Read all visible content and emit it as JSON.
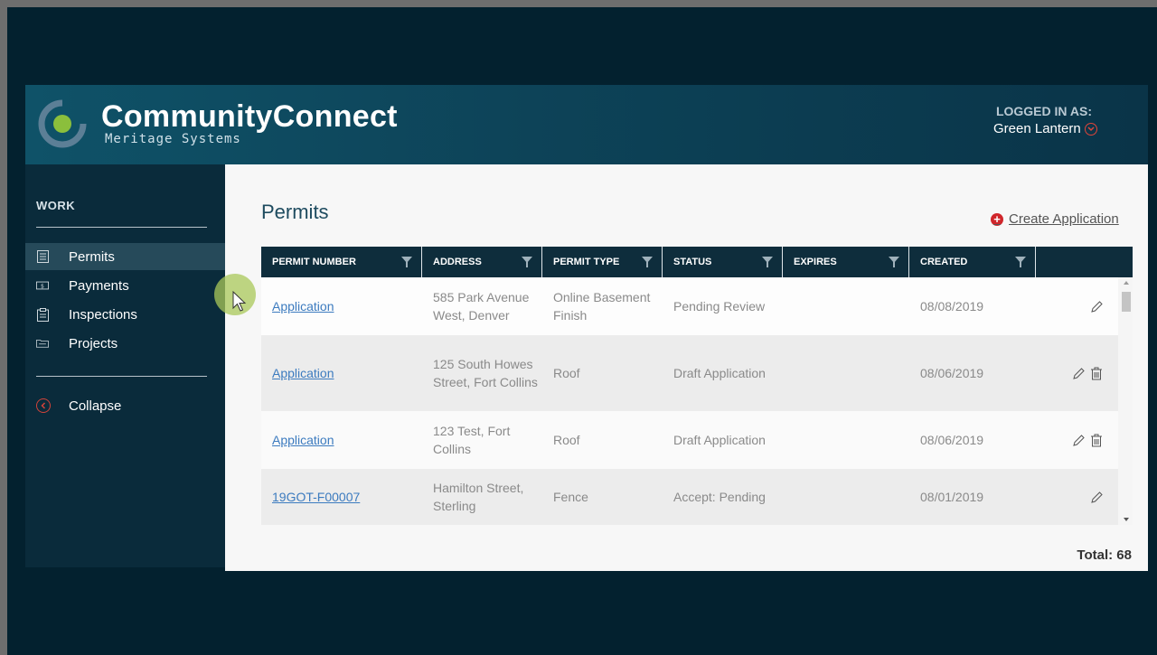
{
  "app": {
    "brand": "CommunityConnect",
    "brand_sub": "Meritage Systems",
    "logged_in_label": "LOGGED IN AS:",
    "user_name": "Green Lantern"
  },
  "sidebar": {
    "heading": "WORK",
    "items": [
      {
        "label": "Permits",
        "icon": "document-icon",
        "active": true
      },
      {
        "label": "Payments",
        "icon": "money-icon",
        "active": false
      },
      {
        "label": "Inspections",
        "icon": "clipboard-icon",
        "active": false
      },
      {
        "label": "Projects",
        "icon": "folder-icon",
        "active": false
      }
    ],
    "collapse_label": "Collapse"
  },
  "main": {
    "title": "Permits",
    "create_label": "Create Application",
    "total_label": "Total: 68"
  },
  "table": {
    "columns": [
      "PERMIT NUMBER",
      "ADDRESS",
      "PERMIT TYPE",
      "STATUS",
      "EXPIRES",
      "CREATED",
      ""
    ],
    "rows": [
      {
        "permit": "Application",
        "address": "585 Park Avenue West, Denver",
        "type": "Online Basement Finish",
        "status": "Pending Review",
        "expires": "",
        "created": "08/08/2019",
        "delete": false
      },
      {
        "permit": "Application",
        "address": "125 South Howes Street, Fort Collins",
        "type": "Roof",
        "status": "Draft Application",
        "expires": "",
        "created": "08/06/2019",
        "delete": true
      },
      {
        "permit": "Application",
        "address": "123 Test, Fort Collins",
        "type": "Roof",
        "status": "Draft Application",
        "expires": "",
        "created": "08/06/2019",
        "delete": true
      },
      {
        "permit": "19GOT-F00007",
        "address": "Hamilton Street, Sterling",
        "type": "Fence",
        "status": "Accept: Pending",
        "expires": "",
        "created": "08/01/2019",
        "delete": false
      }
    ]
  },
  "colors": {
    "background": "#03212f",
    "header": "#0d4358",
    "sidebar": "#0a2b3b",
    "table_header": "#0e2d3c",
    "link": "#3c7bbf",
    "accent_red": "#d0262b",
    "logo_green": "#8bbf3c"
  }
}
